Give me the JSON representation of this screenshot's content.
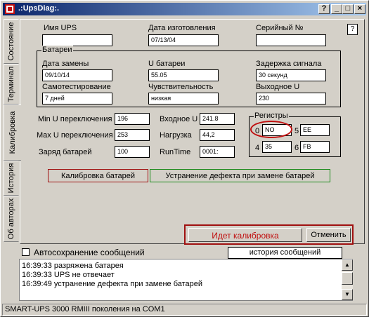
{
  "window": {
    "title": ".:UpsDiag:."
  },
  "title_buttons": {
    "help": "?",
    "minimize": "_",
    "maximize": "□",
    "close": "×"
  },
  "tabs": [
    {
      "label": "Состояние"
    },
    {
      "label": "Терминал"
    },
    {
      "label": "Калибровка"
    },
    {
      "label": "История"
    },
    {
      "label": "Об авторах"
    }
  ],
  "help_button": "?",
  "ups": {
    "name_label": "Имя UPS",
    "name_value": "",
    "mfg_date_label": "Дата изготовления",
    "mfg_date_value": "07/13/04",
    "serial_label": "Серийный №",
    "serial_value": ""
  },
  "batteries": {
    "title": "Батареи",
    "replace_date_label": "Дата замены",
    "replace_date_value": "09/10/14",
    "battery_voltage_label": "U батареи",
    "battery_voltage_value": "55.05",
    "signal_delay_label": "Задержка сигнала",
    "signal_delay_value": "30 секунд",
    "self_test_label": "Самотестирование",
    "self_test_value": "7 дней",
    "sensitivity_label": "Чувствительность",
    "sensitivity_value": "низкая",
    "output_voltage_label": "Выходное U",
    "output_voltage_value": "230"
  },
  "params": {
    "min_u_label": "Min U переключения",
    "min_u_value": "196",
    "max_u_label": "Max U переключения",
    "max_u_value": "253",
    "charge_label": "Заряд батарей",
    "charge_value": "100",
    "input_u_label": "Входное U",
    "input_u_value": "241.8",
    "load_label": "Нагрузка",
    "load_value": "44,2",
    "runtime_label": "RunTime",
    "runtime_value": "0001:"
  },
  "registers": {
    "title": "Регистры",
    "r0_label": "0",
    "r0_value": "NO",
    "r5_label": "5",
    "r5_value": "EE",
    "r4_label": "4",
    "r4_value": "35",
    "r6_label": "6",
    "r6_value": "FB"
  },
  "actions": {
    "calibrate": "Калибровка батарей",
    "fix_defect": "Устранение дефекта при замене батарей",
    "calibrating_status": "Идет калибровка",
    "cancel": "Отменить"
  },
  "autosave": {
    "label": "Автосохранение сообщений",
    "checked": false
  },
  "history_button": "история сообщений",
  "log": [
    "16:39:33 разряжена батарея",
    "16:39:33 UPS не отвечает",
    "16:39:49 устранение дефекта при замене батарей"
  ],
  "status": "SMART-UPS 3000 RMIII поколения на COM1",
  "colors": {
    "title_gradient_start": "#0a246a",
    "title_gradient_end": "#a6caf0",
    "window_face": "#d4d0c8",
    "calibrate_border": "#a01010",
    "fix_border": "#1a8a1a",
    "status_red": "#c01010"
  }
}
